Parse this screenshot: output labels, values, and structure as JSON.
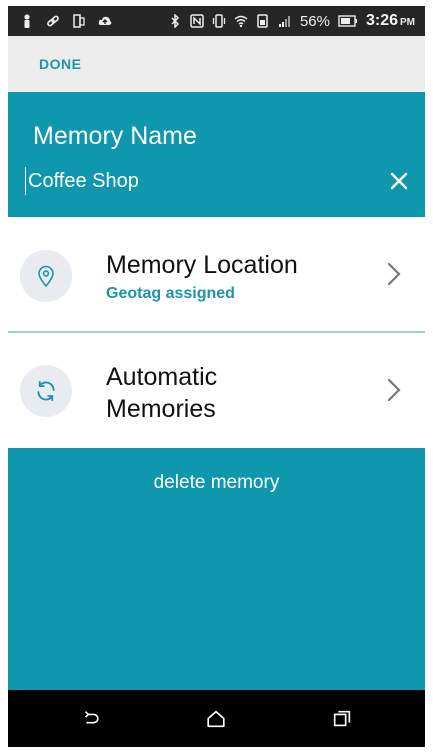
{
  "status_bar": {
    "battery_percent": "56%",
    "time": "3:26",
    "ampm": "PM",
    "left_icons": [
      "person-icon",
      "link-icon",
      "phone-icon",
      "cloud-upload-icon"
    ],
    "right_icons": [
      "bluetooth-icon",
      "nfc-icon",
      "vibrate-icon",
      "wifi-icon",
      "sim-icon",
      "signal-icon",
      "battery-icon"
    ]
  },
  "action_bar": {
    "done_label": "DONE"
  },
  "header": {
    "label": "Memory Name",
    "input_value": "Coffee Shop"
  },
  "items": [
    {
      "title": "Memory Location",
      "subtitle": "Geotag assigned",
      "icon": "location-pin-icon"
    },
    {
      "title": "Automatic Memories",
      "icon": "sync-icon"
    }
  ],
  "delete_label": "delete memory",
  "colors": {
    "accent": "#0e97ad",
    "accent_text": "#1a95aa",
    "action_bar": "#ececec",
    "status_bar": "#262626",
    "nav_bar": "#000000",
    "icon_circle": "#e8ecf0"
  },
  "nav": [
    "back-icon",
    "home-icon",
    "recent-apps-icon"
  ]
}
